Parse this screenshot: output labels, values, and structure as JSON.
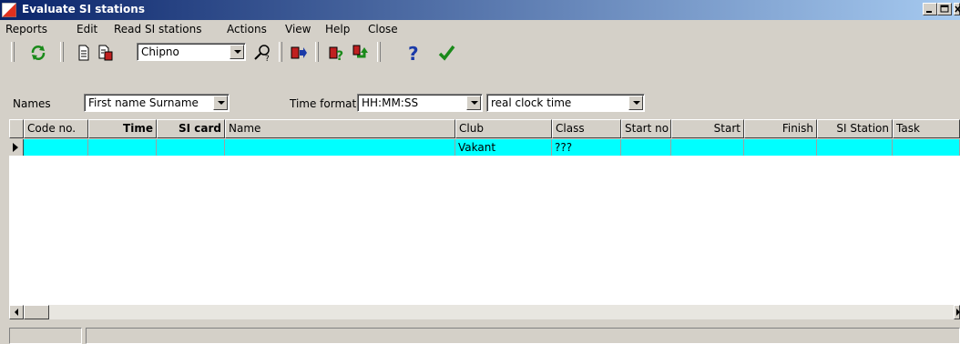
{
  "window": {
    "title": "Evaluate SI stations",
    "controls": [
      "minimize",
      "maximize",
      "close"
    ]
  },
  "menu": [
    "Reports",
    "Edit",
    "Read SI stations",
    "Actions",
    "View",
    "Help",
    "Close"
  ],
  "toolbar": {
    "icons": [
      "refresh-icon",
      "document-icon",
      "document-red-icon",
      "find-icon",
      "exit-icon",
      "query-icon",
      "return-icon",
      "help-icon",
      "check-icon"
    ],
    "search_field": {
      "value": "Chipno"
    }
  },
  "filters": {
    "names_label": "Names",
    "names_value": "First name Surname",
    "time_format_label": "Time format",
    "time_format_value": "HH:MM:SS",
    "time_mode_value": "real clock time"
  },
  "grid": {
    "columns": [
      "Code no.",
      "Time",
      "SI card",
      "Name",
      "Club",
      "Class",
      "Start no",
      "Start",
      "Finish",
      "SI Station",
      "Task"
    ],
    "rows": [
      {
        "code_no": "",
        "time": "",
        "si_card": "",
        "name": "",
        "club": "Vakant",
        "class": "???",
        "start_no": "",
        "start": "",
        "finish": "",
        "si_station": "",
        "task": ""
      }
    ],
    "selected_row_color": "#00ffff"
  },
  "colors": {
    "titlebar_start": "#0a246a",
    "titlebar_end": "#a6caf0",
    "face": "#d4d0c8"
  }
}
